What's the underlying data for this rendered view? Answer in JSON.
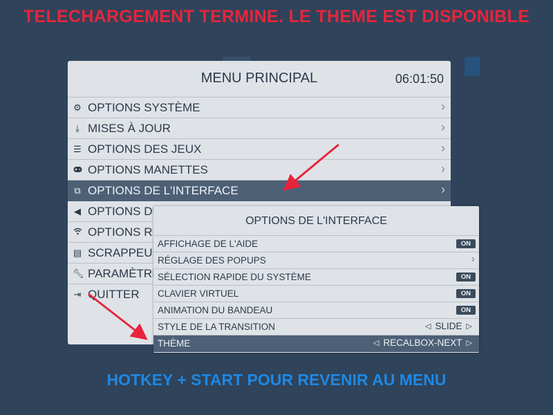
{
  "banners": {
    "top": "TELECHARGEMENT TERMINE. LE THEME EST DISPONIBLE",
    "bottom": "HOTKEY + START POUR REVENIR AU MENU"
  },
  "main_menu": {
    "title": "MENU PRINCIPAL",
    "clock": "06:01:50",
    "items": [
      {
        "label": "OPTIONS SYSTÈME",
        "icon": "gears-icon"
      },
      {
        "label": "MISES À JOUR",
        "icon": "download-icon"
      },
      {
        "label": "OPTIONS DES JEUX",
        "icon": "sliders-icon"
      },
      {
        "label": "OPTIONS MANETTES",
        "icon": "gamepad-icon"
      },
      {
        "label": "OPTIONS DE L'INTERFACE",
        "icon": "interface-icon",
        "selected": true
      },
      {
        "label": "OPTIONS DU",
        "icon": "speaker-icon"
      },
      {
        "label": "OPTIONS RE",
        "icon": "wifi-icon"
      },
      {
        "label": "SCRAPPEUR",
        "icon": "scraper-icon"
      },
      {
        "label": "PARAMÈTRE",
        "icon": "wrench-icon"
      },
      {
        "label": "QUITTER",
        "icon": "exit-icon"
      }
    ]
  },
  "interface_menu": {
    "title": "OPTIONS DE L'INTERFACE",
    "items": [
      {
        "label": "AFFICHAGE DE L'AIDE",
        "control": "toggle",
        "value": "ON"
      },
      {
        "label": "RÉGLAGE DES POPUPS",
        "control": "submenu"
      },
      {
        "label": "SÉLECTION RAPIDE DU SYSTÈME",
        "control": "toggle",
        "value": "ON"
      },
      {
        "label": "CLAVIER VIRTUEL",
        "control": "toggle",
        "value": "ON"
      },
      {
        "label": "ANIMATION DU BANDEAU",
        "control": "toggle",
        "value": "ON"
      },
      {
        "label": "STYLE DE LA TRANSITION",
        "control": "picker",
        "value": "SLIDE"
      },
      {
        "label": "THÈME",
        "control": "picker",
        "value": "RECALBOX-NEXT",
        "selected": true
      }
    ]
  },
  "colors": {
    "background": "#2f435a",
    "top_banner": "#e8243b",
    "bottom_banner": "#1e88e5",
    "arrows": "#e8243b"
  }
}
